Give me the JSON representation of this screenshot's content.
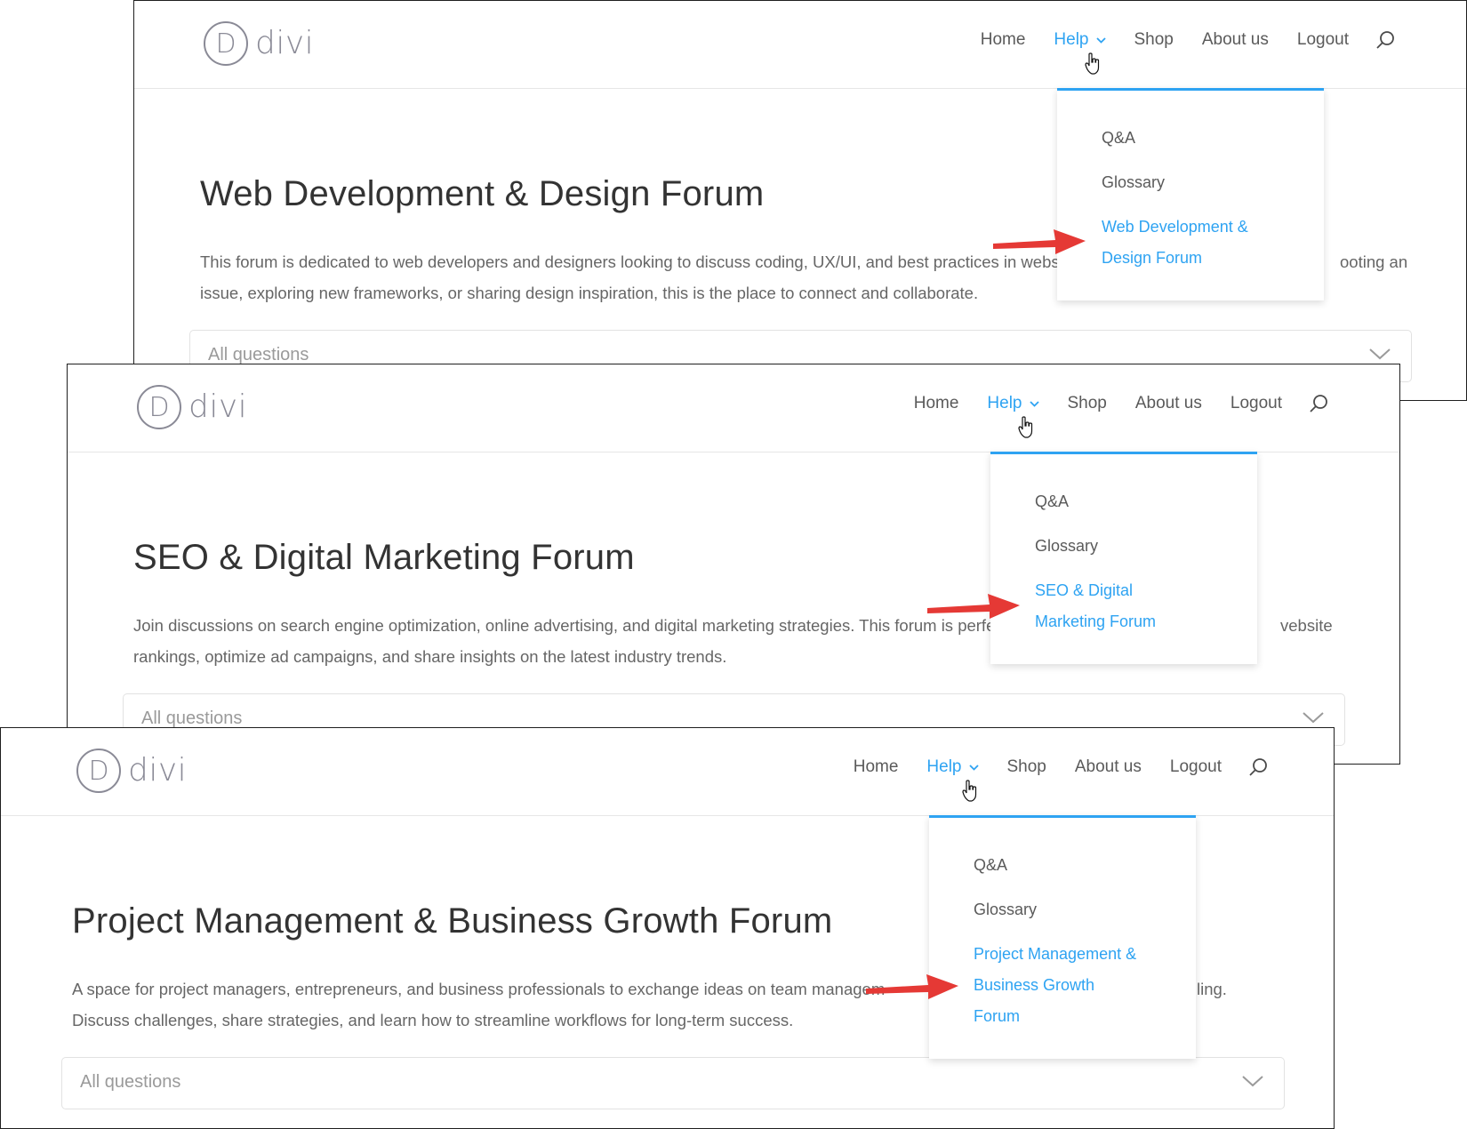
{
  "brand": {
    "logo_letter": "D",
    "logo_word": "divi"
  },
  "nav": {
    "home": "Home",
    "help": "Help",
    "shop": "Shop",
    "about": "About us",
    "logout": "Logout"
  },
  "colors": {
    "accent": "#2ea3f2",
    "arrow": "#e53935",
    "nav_text": "#5a5a5a",
    "body_text": "#666666",
    "title_text": "#333333"
  },
  "icons": {
    "search": "search-icon",
    "dropdown": "chevron-down-icon",
    "pointer": "hand-cursor-icon",
    "annotation": "red-arrow-icon"
  },
  "panels": [
    {
      "title": "Web Development & Design Forum",
      "desc_line1": "This forum is dedicated to web developers and designers looking to discuss coding, UX/UI, and best practices in websit",
      "desc_tail1": "ooting an",
      "desc_line2": "issue, exploring new frameworks, or sharing design inspiration, this is the place to connect and collaborate.",
      "select_placeholder": "All questions",
      "dropdown": {
        "items": [
          "Q&A",
          "Glossary"
        ],
        "active_line1": "Web Development &",
        "active_line2": "Design Forum"
      }
    },
    {
      "title": "SEO & Digital Marketing Forum",
      "desc_line1": "Join discussions on search engine optimization, online advertising, and digital marketing strategies. This forum is perfe",
      "desc_tail1": "vebsite",
      "desc_line2": "rankings, optimize ad campaigns, and share insights on the latest industry trends.",
      "select_placeholder": "All questions",
      "dropdown": {
        "items": [
          "Q&A",
          "Glossary"
        ],
        "active_line1": "SEO & Digital",
        "active_line2": "Marketing Forum"
      }
    },
    {
      "title": "Project Management & Business Growth Forum",
      "desc_line1": "A space for project managers, entrepreneurs, and business professionals to exchange ideas on team managem",
      "desc_tail1": "ling.",
      "desc_line2": "Discuss challenges, share strategies, and learn how to streamline workflows for long-term success.",
      "select_placeholder": "All questions",
      "dropdown": {
        "items": [
          "Q&A",
          "Glossary"
        ],
        "active_line1": "Project Management &",
        "active_line2": "Business Growth",
        "active_line3": "Forum"
      }
    }
  ]
}
